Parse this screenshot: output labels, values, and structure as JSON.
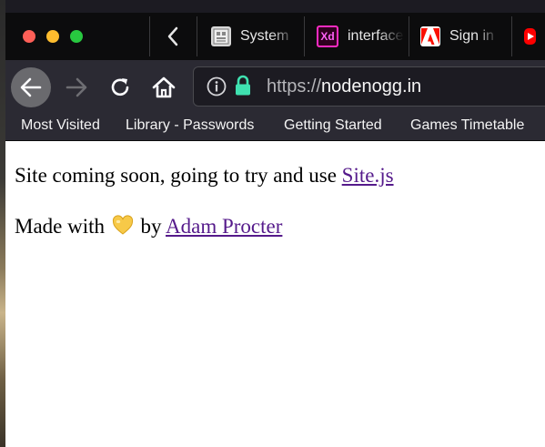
{
  "tabs": [
    {
      "title": "System",
      "icon": "system-preferences-icon"
    },
    {
      "title": "interface",
      "icon": "adobe-xd-icon"
    },
    {
      "title": "Sign in",
      "icon": "adobe-icon"
    },
    {
      "title": "",
      "icon": "youtube-icon"
    }
  ],
  "navbar": {
    "url_protocol": "https://",
    "url_host": "nodenogg.in"
  },
  "bookmarks": [
    "Most Visited",
    "Library - Passwords",
    "Getting Started",
    "Games Timetable"
  ],
  "page": {
    "line1_text": "Site coming soon, going to try and use ",
    "line1_link": "Site.js",
    "line2_prefix": "Made with",
    "line2_by": "by",
    "line2_link": "Adam Procter"
  },
  "colors": {
    "link": "#551a8b",
    "lock": "#3fe1b0",
    "heart": "#f7c948"
  }
}
